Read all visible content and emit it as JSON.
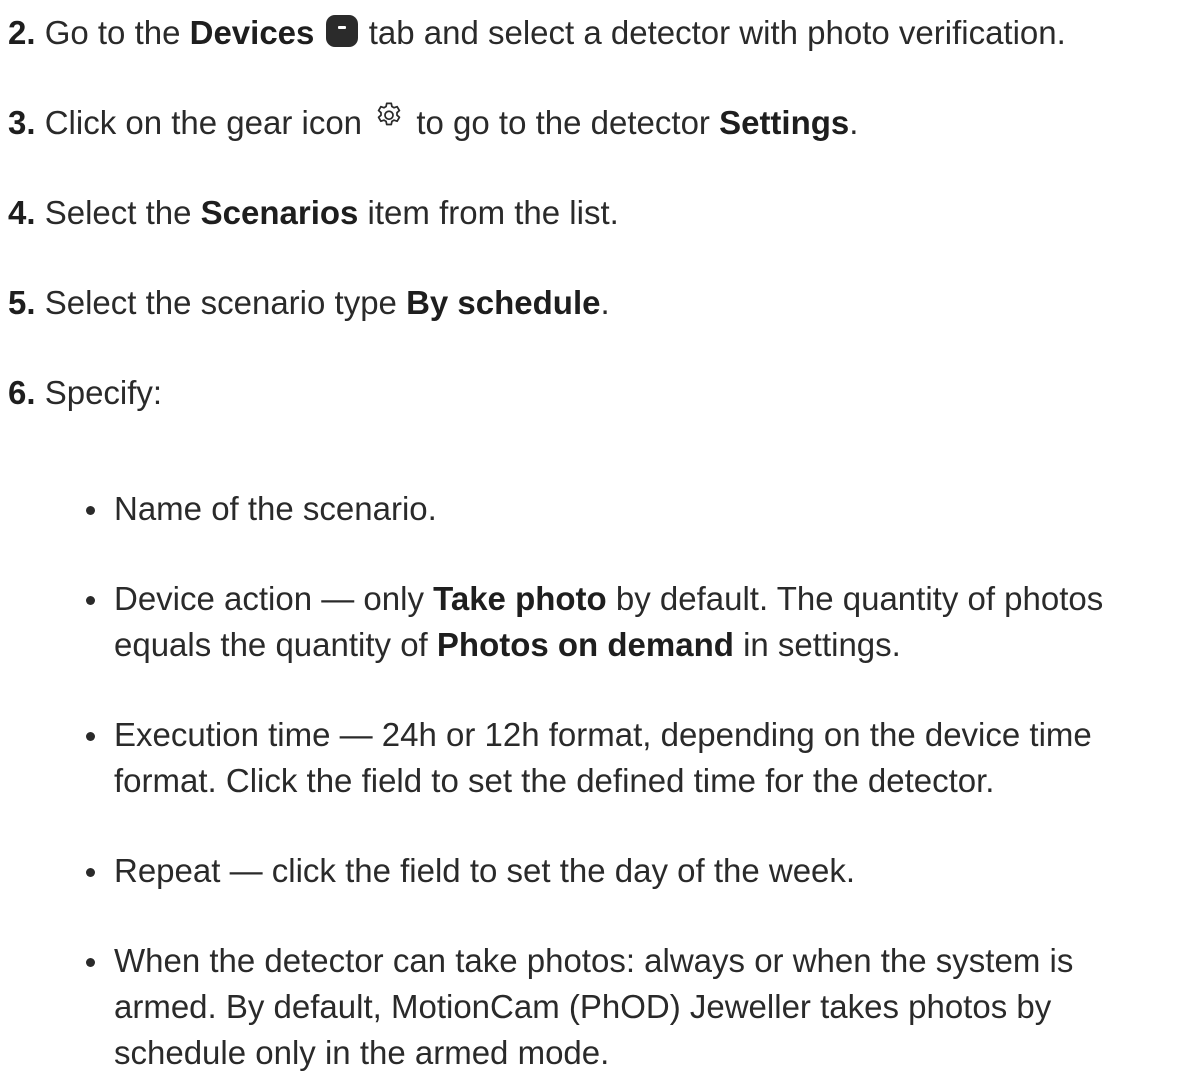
{
  "steps": [
    {
      "number": "2.",
      "pre": " Go to the ",
      "bold": "Devices",
      "icon": "devices-icon",
      "post": " tab and select a detector with photo verification."
    },
    {
      "number": "3.",
      "pre": " Click on the gear icon ",
      "icon": "gear-icon",
      "mid": " to go to the detector ",
      "bold": "Settings",
      "post": "."
    },
    {
      "number": "4.",
      "pre": " Select the ",
      "bold": "Scenarios",
      "post": " item from the list."
    },
    {
      "number": "5.",
      "pre": " Select the scenario type ",
      "bold": "By schedule",
      "post": "."
    },
    {
      "number": "6.",
      "text": " Specify:"
    }
  ],
  "bullets": [
    {
      "text": "Name of the scenario."
    },
    {
      "pre": "Device action — only ",
      "bold1": "Take photo",
      "mid": " by default. The quantity of photos equals the quantity of ",
      "bold2": "Photos on demand",
      "post": " in settings."
    },
    {
      "text": "Execution time — 24h or 12h format, depending on the device time format. Click the field to set the defined time for the detector."
    },
    {
      "text": "Repeat — click the field to set the day of the week."
    },
    {
      "text": "When the detector can take photos: always or when the system is armed. By default, MotionCam (PhOD) Jeweller takes photos by schedule only in the armed mode."
    }
  ]
}
